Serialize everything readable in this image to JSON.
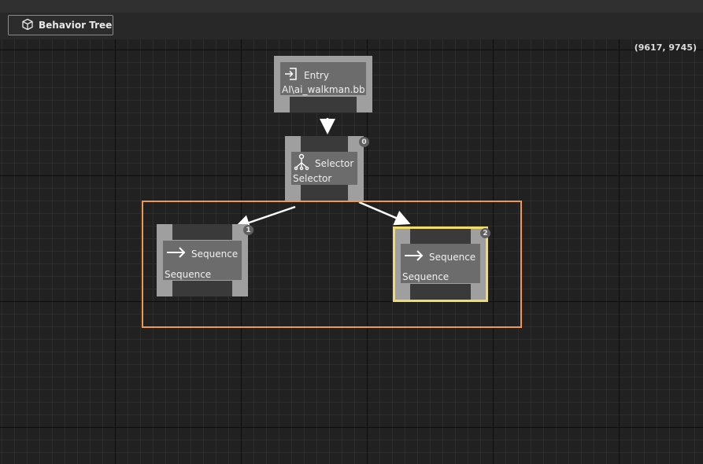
{
  "toolbar": {
    "behavior_tree_label": "Behavior Tree",
    "icon": "cube-icon"
  },
  "canvas": {
    "coords": "(9617, 9745)"
  },
  "nodes": {
    "entry": {
      "title": "Entry",
      "subtitle": "AI\\ai_walkman.bb",
      "icon": "enter-icon"
    },
    "selector": {
      "title": "Selector",
      "subtitle": "Selector",
      "badge": "0",
      "icon": "selector-icon"
    },
    "sequence1": {
      "title": "Sequence",
      "subtitle": "Sequence",
      "badge": "1",
      "icon": "arrow-right-icon"
    },
    "sequence2": {
      "title": "Sequence",
      "subtitle": "Sequence",
      "badge": "2",
      "icon": "arrow-right-icon",
      "selected": true
    }
  },
  "colors": {
    "group_outline": "#ee9a4d",
    "selection_outline": "#f0dc6a",
    "node_frame": "#9f9f9f",
    "node_body": "#6c6c6c"
  }
}
